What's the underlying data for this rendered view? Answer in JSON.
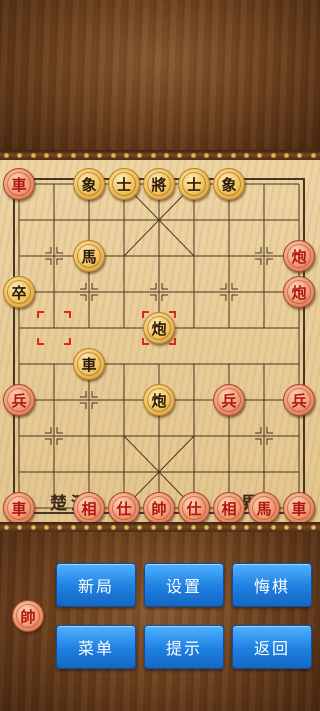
{
  "board": {
    "river_left": "楚河",
    "river_right": "漢界",
    "pieces": [
      {
        "char": "車",
        "side": "red",
        "col": 0,
        "row": 0,
        "name": "piece-black-chariot-left"
      },
      {
        "char": "象",
        "side": "black",
        "col": 2,
        "row": 0,
        "name": "piece-black-elephant-left"
      },
      {
        "char": "士",
        "side": "black",
        "col": 3,
        "row": 0,
        "name": "piece-black-advisor-left"
      },
      {
        "char": "將",
        "side": "black",
        "col": 4,
        "row": 0,
        "name": "piece-black-general"
      },
      {
        "char": "士",
        "side": "black",
        "col": 5,
        "row": 0,
        "name": "piece-black-advisor-right"
      },
      {
        "char": "象",
        "side": "black",
        "col": 6,
        "row": 0,
        "name": "piece-black-elephant-right"
      },
      {
        "char": "馬",
        "side": "black",
        "col": 2,
        "row": 2,
        "name": "piece-black-horse"
      },
      {
        "char": "炮",
        "side": "red",
        "col": 8,
        "row": 2,
        "name": "piece-red-cannon-a"
      },
      {
        "char": "卒",
        "side": "black",
        "col": 0,
        "row": 3,
        "name": "piece-black-soldier"
      },
      {
        "char": "炮",
        "side": "red",
        "col": 8,
        "row": 3,
        "name": "piece-red-cannon-b"
      },
      {
        "char": "炮",
        "side": "black",
        "col": 4,
        "row": 4,
        "name": "piece-black-cannon-selected"
      },
      {
        "char": "車",
        "side": "black",
        "col": 2,
        "row": 5,
        "name": "piece-black-chariot"
      },
      {
        "char": "兵",
        "side": "red",
        "col": 0,
        "row": 6,
        "name": "piece-red-soldier-left"
      },
      {
        "char": "炮",
        "side": "black",
        "col": 4,
        "row": 6,
        "name": "piece-black-cannon"
      },
      {
        "char": "兵",
        "side": "red",
        "col": 6,
        "row": 6,
        "name": "piece-red-soldier-mid"
      },
      {
        "char": "兵",
        "side": "red",
        "col": 8,
        "row": 6,
        "name": "piece-red-soldier-right"
      },
      {
        "char": "車",
        "side": "red",
        "col": 0,
        "row": 9,
        "name": "piece-red-chariot-left"
      },
      {
        "char": "相",
        "side": "red",
        "col": 2,
        "row": 9,
        "name": "piece-red-elephant-left"
      },
      {
        "char": "仕",
        "side": "red",
        "col": 3,
        "row": 9,
        "name": "piece-red-advisor-left"
      },
      {
        "char": "帥",
        "side": "red",
        "col": 4,
        "row": 9,
        "name": "piece-red-general"
      },
      {
        "char": "仕",
        "side": "red",
        "col": 5,
        "row": 9,
        "name": "piece-red-advisor-right"
      },
      {
        "char": "相",
        "side": "red",
        "col": 6,
        "row": 9,
        "name": "piece-red-elephant-right"
      },
      {
        "char": "馬",
        "side": "red",
        "col": 7,
        "row": 9,
        "name": "piece-red-horse"
      },
      {
        "char": "車",
        "side": "red",
        "col": 8,
        "row": 9,
        "name": "piece-red-chariot-right"
      }
    ],
    "selected_previous": {
      "col": 1,
      "row": 4
    },
    "selected_current": {
      "col": 4,
      "row": 4
    }
  },
  "turn_indicator": {
    "char": "帥",
    "side": "red"
  },
  "buttons": {
    "new_game": "新局",
    "settings": "设置",
    "undo": "悔棋",
    "menu": "菜单",
    "hint": "提示",
    "back": "返回"
  }
}
